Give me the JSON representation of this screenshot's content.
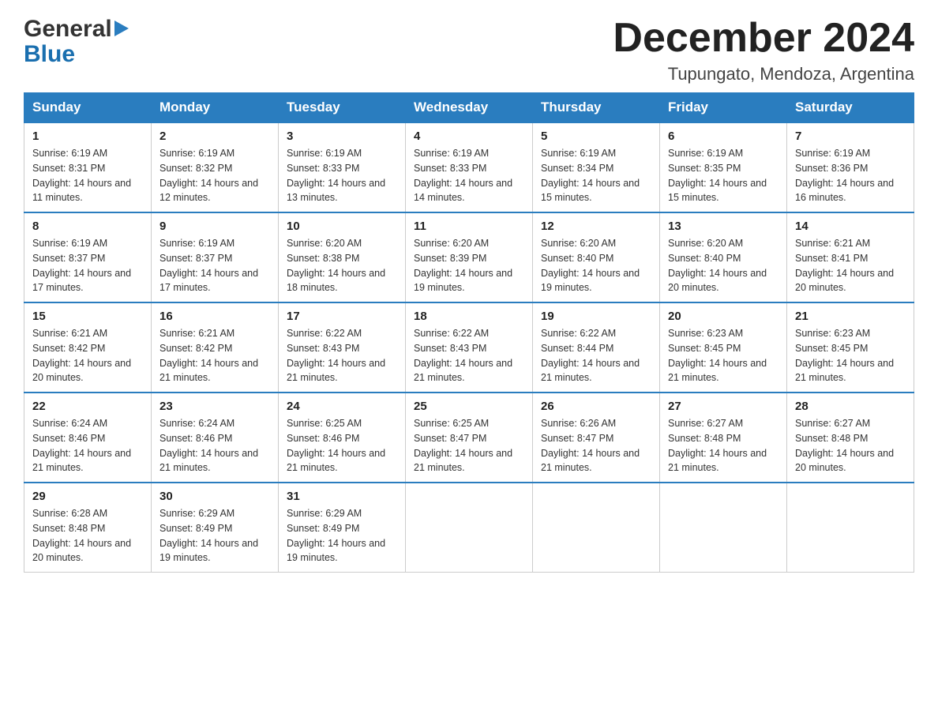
{
  "header": {
    "logo_general": "General",
    "logo_blue": "Blue",
    "title": "December 2024",
    "subtitle": "Tupungato, Mendoza, Argentina"
  },
  "calendar": {
    "days_of_week": [
      "Sunday",
      "Monday",
      "Tuesday",
      "Wednesday",
      "Thursday",
      "Friday",
      "Saturday"
    ],
    "weeks": [
      [
        {
          "day": "1",
          "sunrise": "6:19 AM",
          "sunset": "8:31 PM",
          "daylight": "14 hours and 11 minutes."
        },
        {
          "day": "2",
          "sunrise": "6:19 AM",
          "sunset": "8:32 PM",
          "daylight": "14 hours and 12 minutes."
        },
        {
          "day": "3",
          "sunrise": "6:19 AM",
          "sunset": "8:33 PM",
          "daylight": "14 hours and 13 minutes."
        },
        {
          "day": "4",
          "sunrise": "6:19 AM",
          "sunset": "8:33 PM",
          "daylight": "14 hours and 14 minutes."
        },
        {
          "day": "5",
          "sunrise": "6:19 AM",
          "sunset": "8:34 PM",
          "daylight": "14 hours and 15 minutes."
        },
        {
          "day": "6",
          "sunrise": "6:19 AM",
          "sunset": "8:35 PM",
          "daylight": "14 hours and 15 minutes."
        },
        {
          "day": "7",
          "sunrise": "6:19 AM",
          "sunset": "8:36 PM",
          "daylight": "14 hours and 16 minutes."
        }
      ],
      [
        {
          "day": "8",
          "sunrise": "6:19 AM",
          "sunset": "8:37 PM",
          "daylight": "14 hours and 17 minutes."
        },
        {
          "day": "9",
          "sunrise": "6:19 AM",
          "sunset": "8:37 PM",
          "daylight": "14 hours and 17 minutes."
        },
        {
          "day": "10",
          "sunrise": "6:20 AM",
          "sunset": "8:38 PM",
          "daylight": "14 hours and 18 minutes."
        },
        {
          "day": "11",
          "sunrise": "6:20 AM",
          "sunset": "8:39 PM",
          "daylight": "14 hours and 19 minutes."
        },
        {
          "day": "12",
          "sunrise": "6:20 AM",
          "sunset": "8:40 PM",
          "daylight": "14 hours and 19 minutes."
        },
        {
          "day": "13",
          "sunrise": "6:20 AM",
          "sunset": "8:40 PM",
          "daylight": "14 hours and 20 minutes."
        },
        {
          "day": "14",
          "sunrise": "6:21 AM",
          "sunset": "8:41 PM",
          "daylight": "14 hours and 20 minutes."
        }
      ],
      [
        {
          "day": "15",
          "sunrise": "6:21 AM",
          "sunset": "8:42 PM",
          "daylight": "14 hours and 20 minutes."
        },
        {
          "day": "16",
          "sunrise": "6:21 AM",
          "sunset": "8:42 PM",
          "daylight": "14 hours and 21 minutes."
        },
        {
          "day": "17",
          "sunrise": "6:22 AM",
          "sunset": "8:43 PM",
          "daylight": "14 hours and 21 minutes."
        },
        {
          "day": "18",
          "sunrise": "6:22 AM",
          "sunset": "8:43 PM",
          "daylight": "14 hours and 21 minutes."
        },
        {
          "day": "19",
          "sunrise": "6:22 AM",
          "sunset": "8:44 PM",
          "daylight": "14 hours and 21 minutes."
        },
        {
          "day": "20",
          "sunrise": "6:23 AM",
          "sunset": "8:45 PM",
          "daylight": "14 hours and 21 minutes."
        },
        {
          "day": "21",
          "sunrise": "6:23 AM",
          "sunset": "8:45 PM",
          "daylight": "14 hours and 21 minutes."
        }
      ],
      [
        {
          "day": "22",
          "sunrise": "6:24 AM",
          "sunset": "8:46 PM",
          "daylight": "14 hours and 21 minutes."
        },
        {
          "day": "23",
          "sunrise": "6:24 AM",
          "sunset": "8:46 PM",
          "daylight": "14 hours and 21 minutes."
        },
        {
          "day": "24",
          "sunrise": "6:25 AM",
          "sunset": "8:46 PM",
          "daylight": "14 hours and 21 minutes."
        },
        {
          "day": "25",
          "sunrise": "6:25 AM",
          "sunset": "8:47 PM",
          "daylight": "14 hours and 21 minutes."
        },
        {
          "day": "26",
          "sunrise": "6:26 AM",
          "sunset": "8:47 PM",
          "daylight": "14 hours and 21 minutes."
        },
        {
          "day": "27",
          "sunrise": "6:27 AM",
          "sunset": "8:48 PM",
          "daylight": "14 hours and 21 minutes."
        },
        {
          "day": "28",
          "sunrise": "6:27 AM",
          "sunset": "8:48 PM",
          "daylight": "14 hours and 20 minutes."
        }
      ],
      [
        {
          "day": "29",
          "sunrise": "6:28 AM",
          "sunset": "8:48 PM",
          "daylight": "14 hours and 20 minutes."
        },
        {
          "day": "30",
          "sunrise": "6:29 AM",
          "sunset": "8:49 PM",
          "daylight": "14 hours and 19 minutes."
        },
        {
          "day": "31",
          "sunrise": "6:29 AM",
          "sunset": "8:49 PM",
          "daylight": "14 hours and 19 minutes."
        },
        null,
        null,
        null,
        null
      ]
    ]
  }
}
